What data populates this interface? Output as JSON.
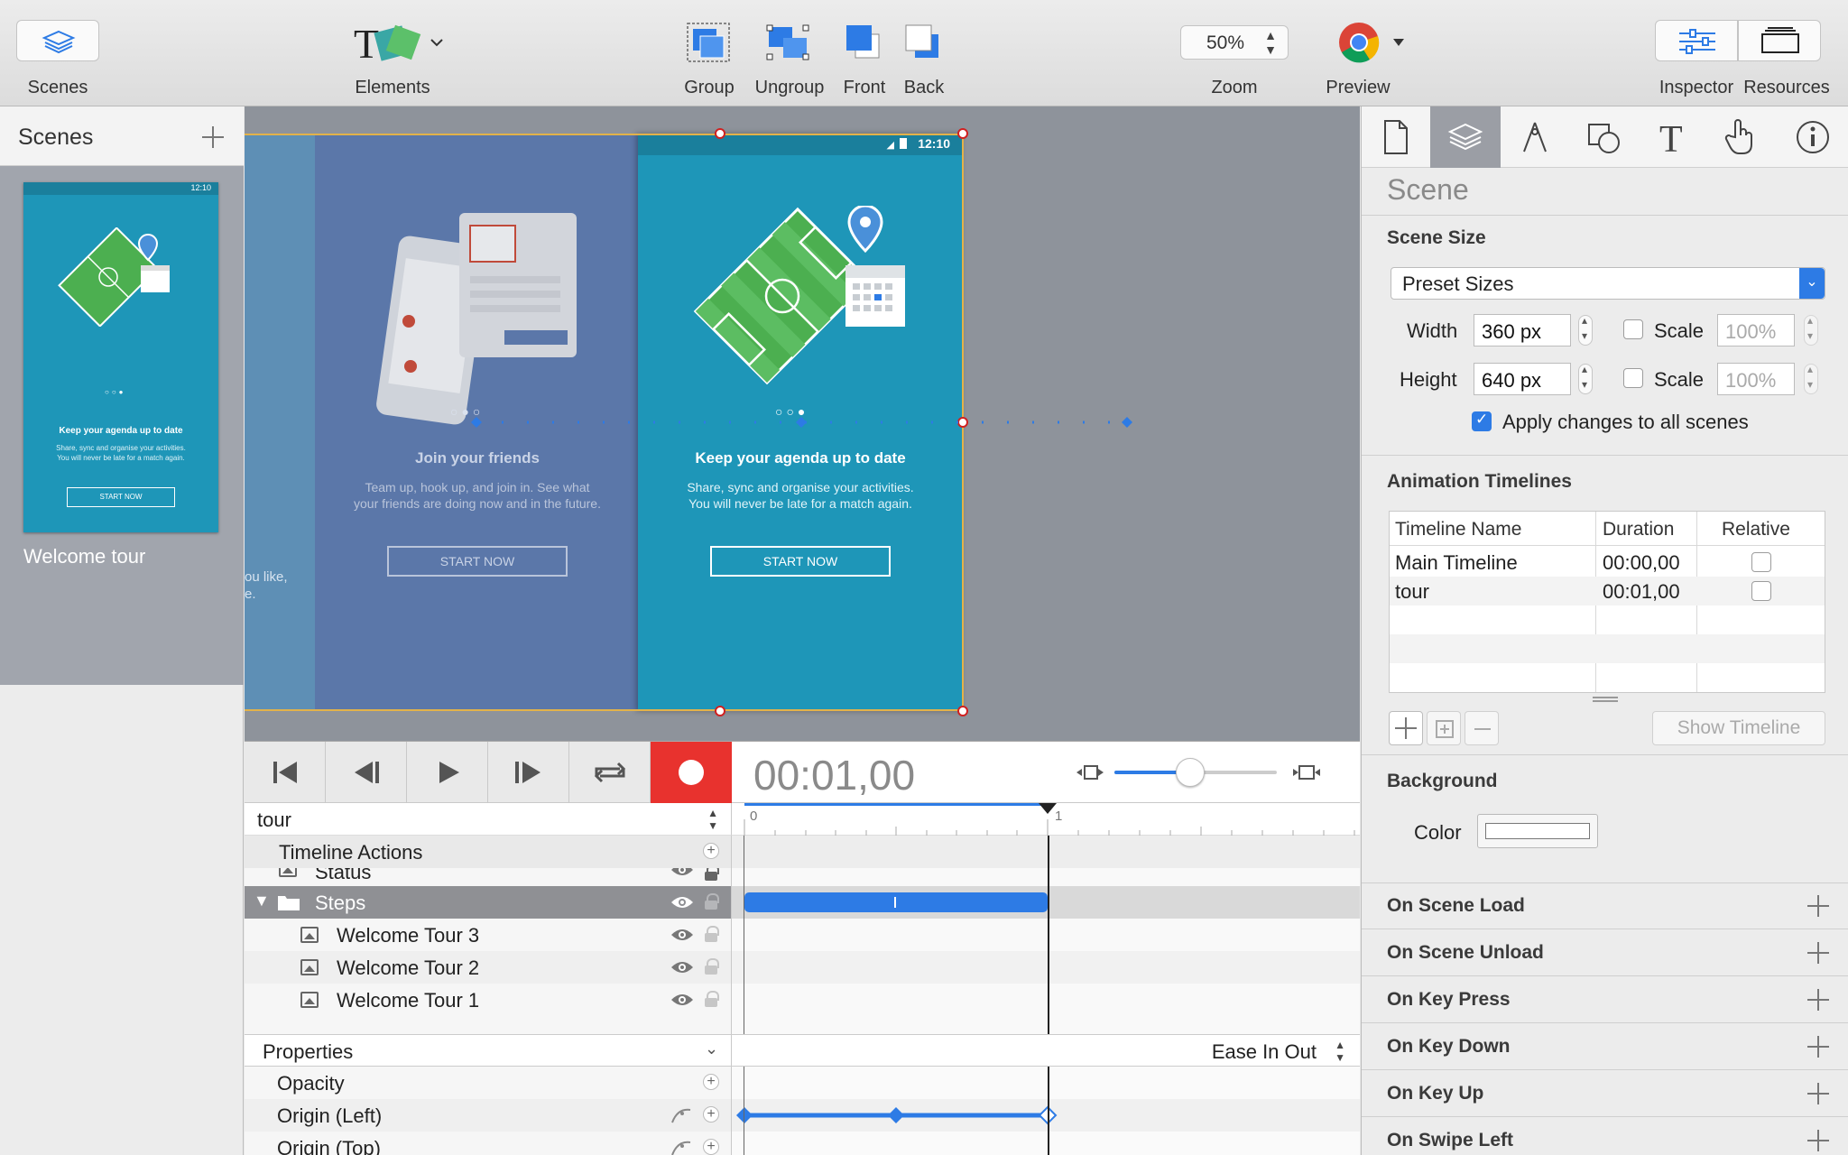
{
  "toolbar": {
    "scenes_label": "Scenes",
    "elements_label": "Elements",
    "group_label": "Group",
    "ungroup_label": "Ungroup",
    "front_label": "Front",
    "back_label": "Back",
    "zoom_value": "50%",
    "zoom_label": "Zoom",
    "preview_label": "Preview",
    "inspector_label": "Inspector",
    "resources_label": "Resources"
  },
  "scenes_panel": {
    "title": "Scenes",
    "scene_name": "Welcome tour",
    "thumb_time": "12:10",
    "thumb_heading": "Keep your agenda up to date",
    "thumb_body_1": "Share, sync and organise your activities.",
    "thumb_body_2": "You will never be late for a match again.",
    "thumb_button": "START NOW"
  },
  "canvas": {
    "partial_text_1": "ou like,",
    "partial_text_2": "e.",
    "screen2": {
      "heading": "Join your friends",
      "body_1": "Team up, hook up, and join in. See what",
      "body_2": "your friends are doing now and in the future.",
      "button": "START NOW"
    },
    "screen3": {
      "time": "12:10",
      "heading": "Keep your agenda up to date",
      "body_1": "Share, sync and organise your activities.",
      "body_2": "You will never be late for a match again.",
      "button": "START NOW"
    }
  },
  "timeline": {
    "current_time": "00:01,00",
    "timeline_select": "tour",
    "timeline_actions": "Timeline Actions",
    "ruler_0": "0",
    "ruler_1": "1",
    "layers": [
      "Status",
      "Steps",
      "Welcome Tour 3",
      "Welcome Tour 2",
      "Welcome Tour 1"
    ],
    "properties_label": "Properties",
    "easing": "Ease In Out",
    "properties": [
      "Opacity",
      "Origin (Left)",
      "Origin (Top)"
    ]
  },
  "inspector": {
    "section_title": "Scene",
    "scene_size_title": "Scene Size",
    "preset": "Preset Sizes",
    "width_label": "Width",
    "width_value": "360 px",
    "height_label": "Height",
    "height_value": "640 px",
    "scale_label": "Scale",
    "scale_value": "100%",
    "apply_all": "Apply changes to all scenes",
    "anim_title": "Animation Timelines",
    "table_headers": [
      "Timeline Name",
      "Duration",
      "Relative"
    ],
    "table_rows": [
      {
        "name": "Main Timeline",
        "duration": "00:00,00"
      },
      {
        "name": "tour",
        "duration": "00:01,00"
      }
    ],
    "show_timeline": "Show Timeline",
    "background_title": "Background",
    "color_label": "Color",
    "events": [
      "On Scene Load",
      "On Scene Unload",
      "On Key Press",
      "On Key Down",
      "On Key Up",
      "On Swipe Left"
    ]
  },
  "colors": {
    "accent": "#2d7be5",
    "record": "#e8322e",
    "screen_teal": "#1e96b8",
    "screen_blue": "#5b77a9"
  }
}
